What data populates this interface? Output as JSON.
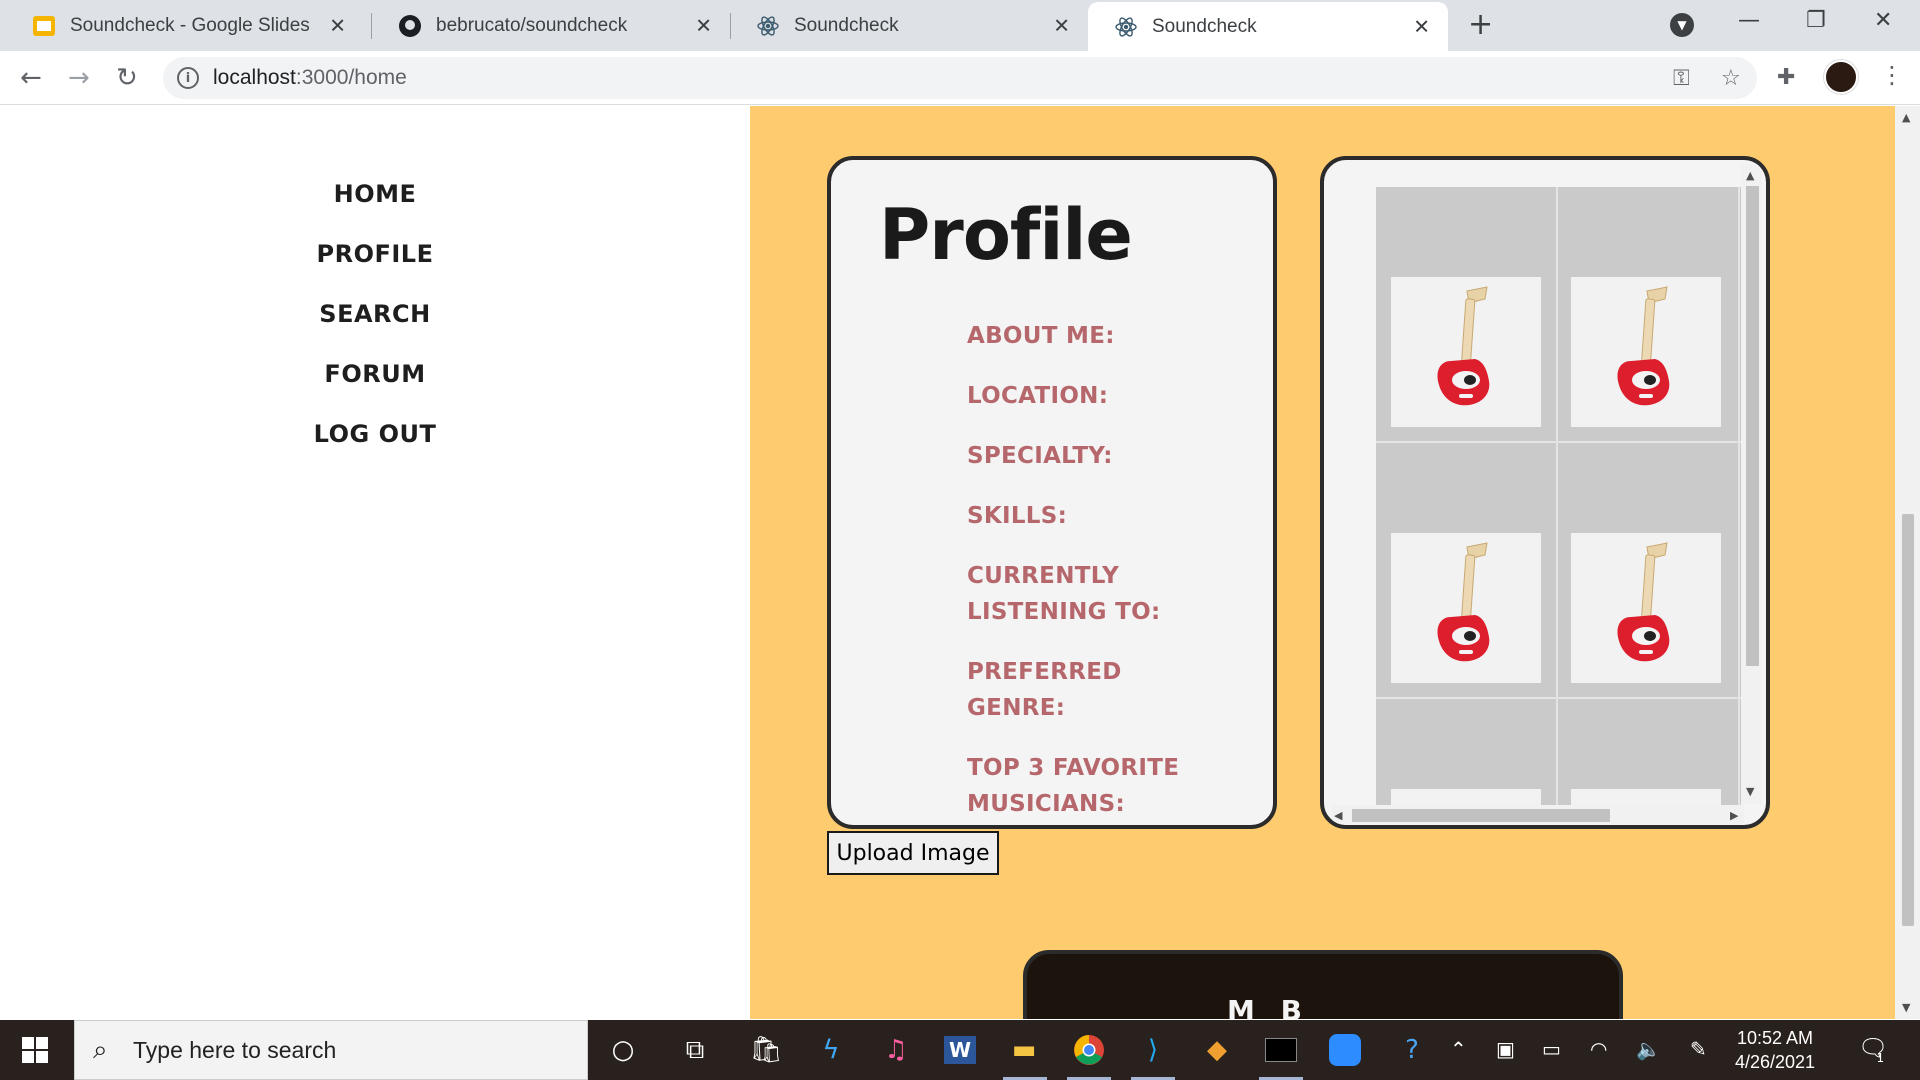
{
  "browser": {
    "tabs": [
      {
        "title": "Soundcheck - Google Slides",
        "icon": "google-slides-icon"
      },
      {
        "title": "bebrucato/soundcheck",
        "icon": "github-icon"
      },
      {
        "title": "Soundcheck",
        "icon": "react-icon"
      },
      {
        "title": "Soundcheck",
        "icon": "react-icon",
        "active": true
      }
    ],
    "new_tab_glyph": "+",
    "url_host": "localhost",
    "url_path": ":3000/home"
  },
  "sidebar": {
    "items": [
      {
        "label": "HOME"
      },
      {
        "label": "PROFILE"
      },
      {
        "label": "SEARCH"
      },
      {
        "label": "FORUM"
      },
      {
        "label": "LOG OUT"
      }
    ]
  },
  "profile": {
    "title": "Profile",
    "fields": [
      {
        "label": "ABOUT ME:"
      },
      {
        "label": "LOCATION:"
      },
      {
        "label": "SPECIALTY:"
      },
      {
        "label": "SKILLS:"
      },
      {
        "label": "CURRENTLY LISTENING TO:"
      },
      {
        "label": "PREFERRED GENRE:"
      },
      {
        "label": "TOP 3 FAVORITE MUSICIANS:"
      }
    ],
    "upload_label": "Upload Image"
  },
  "gallery": {
    "thumbnails": [
      "guitar-image",
      "guitar-image",
      "guitar-image",
      "guitar-image"
    ]
  },
  "bottom_card": {
    "label": "M   B  "
  },
  "taskbar": {
    "search_placeholder": "Type here to search",
    "time": "10:52 AM",
    "date": "4/26/2021",
    "notification_count": "1"
  },
  "colors": {
    "main_background": "#fecb6f",
    "field_label": "#b6676c",
    "card_background": "#f4f4f4"
  }
}
